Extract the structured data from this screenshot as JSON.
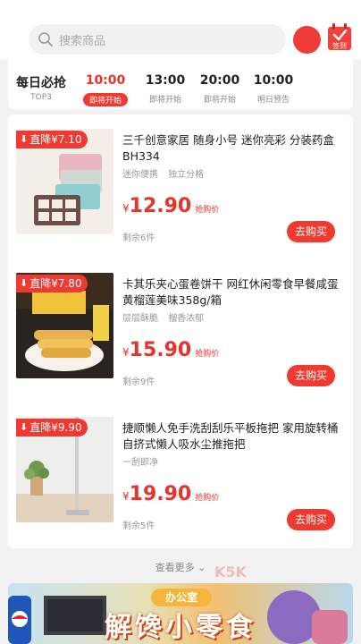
{
  "header": {
    "search_placeholder": "搜索商品",
    "signin_label": "签到"
  },
  "tabs": [
    {
      "time": "每日必抢",
      "status": "TOP3"
    },
    {
      "time": "10:00",
      "status": "即将开始"
    },
    {
      "time": "13:00",
      "status": "即将开始"
    },
    {
      "time": "20:00",
      "status": "即将开始"
    },
    {
      "time": "10:00",
      "status": "明日预告"
    }
  ],
  "products": [
    {
      "badge": "直降¥7.10",
      "title": "三千创意家居 随身小号 迷你亮彩 分装药盒BH334",
      "tags": [
        "迷你便携",
        "独立分格"
      ],
      "currency": "¥",
      "price": "12.90",
      "price_label": "抢购价",
      "remaining": "剩余6件",
      "buy_label": "去购买"
    },
    {
      "badge": "直降¥7.80",
      "title": "卡其乐夹心蛋卷饼干 网红休闲零食早餐咸蛋黄榴莲美味358g/箱",
      "tags": [
        "层层酥脆",
        "榴香浓郁"
      ],
      "currency": "¥",
      "price": "15.90",
      "price_label": "抢购价",
      "remaining": "剩余9件",
      "buy_label": "去购买"
    },
    {
      "badge": "直降¥9.90",
      "title": "捷顺懒人免手洗刮刮乐平板拖把 家用旋转桶自挤式懒人吸水尘推拖把",
      "tags": [
        "一刮即净"
      ],
      "currency": "¥",
      "price": "19.90",
      "price_label": "抢购价",
      "remaining": "剩余5件",
      "buy_label": "去购买"
    }
  ],
  "more_label": "查看更多",
  "banner": {
    "small": "办公室",
    "big": "解馋小零食"
  },
  "colors": {
    "accent": "#f03a2f",
    "price": "#e8322c"
  }
}
